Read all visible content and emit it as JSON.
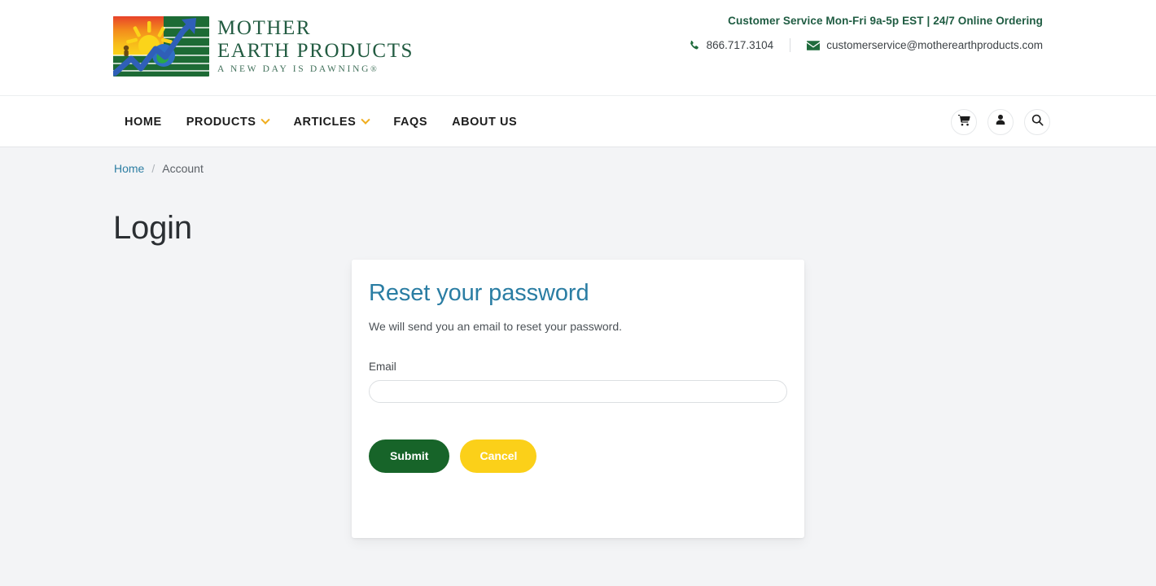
{
  "brand": {
    "logo_icon": "sunrise-field-arrow-globe-logo",
    "name_line1": "MOTHER",
    "name_line2": "EARTH PRODUCTS",
    "tagline": "A NEW DAY IS DAWNING",
    "tagline_mark": "®",
    "text_color": "#235c42"
  },
  "header": {
    "service_hours": "Customer Service Mon-Fri 9a-5p EST | 24/7 Online Ordering",
    "phone_icon": "phone-icon",
    "phone": "866.717.3104",
    "email_icon": "envelope-icon",
    "email": "customerservice@motherearthproducts.com",
    "accent_color": "#1f5c42"
  },
  "nav": {
    "items": [
      {
        "label": "HOME",
        "has_dropdown": false
      },
      {
        "label": "PRODUCTS",
        "has_dropdown": true
      },
      {
        "label": "ARTICLES",
        "has_dropdown": true
      },
      {
        "label": "FAQS",
        "has_dropdown": false
      },
      {
        "label": "ABOUT US",
        "has_dropdown": false
      }
    ],
    "icons": [
      {
        "name": "cart-icon"
      },
      {
        "name": "user-account-icon"
      },
      {
        "name": "search-icon"
      }
    ],
    "caret_color": "#f0ad1e"
  },
  "breadcrumb": {
    "home": "Home",
    "separator": "/",
    "current": "Account",
    "link_color": "#2d7ea3"
  },
  "page": {
    "title": "Login",
    "background_color": "#f3f4f6"
  },
  "card": {
    "title": "Reset your password",
    "title_color": "#2a7da3",
    "description": "We will send you an email to reset your password.",
    "email_label": "Email",
    "email_value": "",
    "email_placeholder": "",
    "submit_label": "Submit",
    "cancel_label": "Cancel",
    "submit_color": "#176429",
    "cancel_color": "#fbd019"
  }
}
